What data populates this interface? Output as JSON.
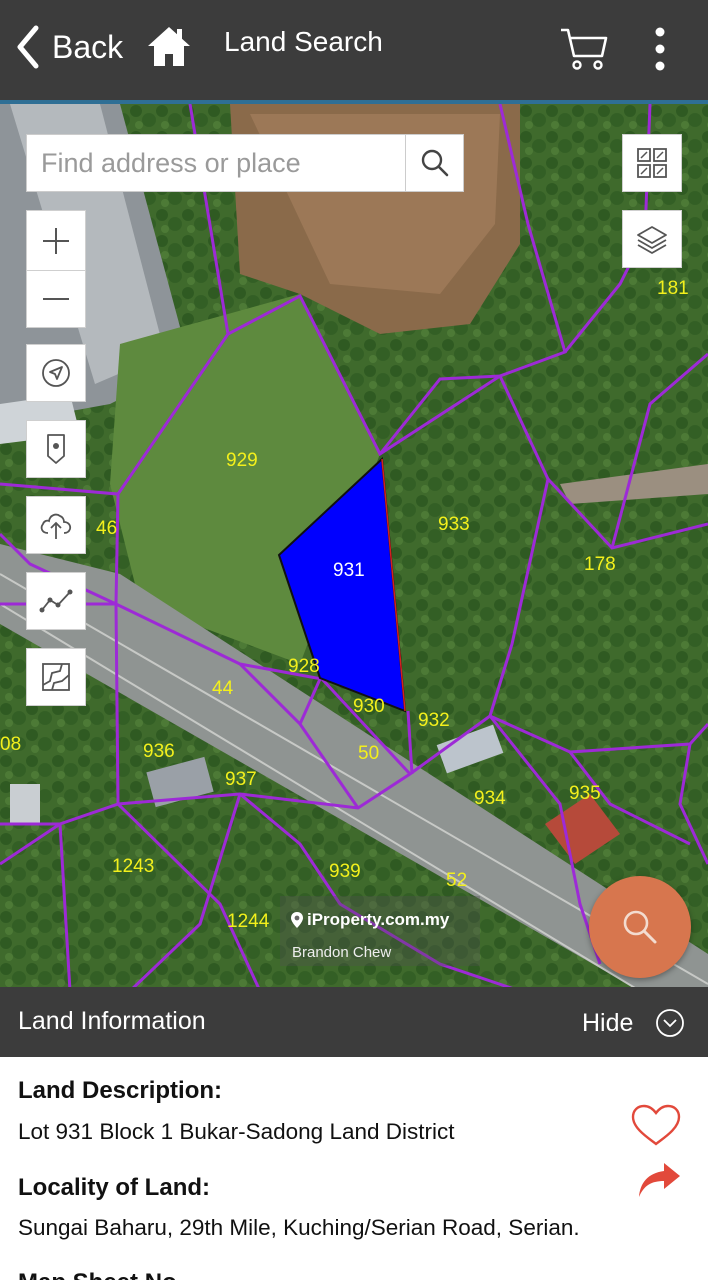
{
  "header": {
    "back_label": "Back",
    "title": "Land Search"
  },
  "map": {
    "search_placeholder": "Find address or place",
    "watermark": "iProperty.com.my",
    "credit": "Brandon Chew",
    "selected_lot": "931",
    "lots": [
      "929",
      "933",
      "46",
      "181",
      "178",
      "931",
      "928",
      "44",
      "930",
      "932",
      "50",
      "936",
      "937",
      "934",
      "935",
      "1243",
      "939",
      "52",
      "1244",
      "08"
    ],
    "boundary_color": "#9d2ad6",
    "selected_fill": "#0000ff",
    "lot_label_color": "#f3f01c"
  },
  "info": {
    "title": "Land Information",
    "hide_label": "Hide",
    "land_description_label": "Land Description:",
    "land_description": "Lot 931 Block 1 Bukar-Sadong Land District",
    "locality_label": "Locality of Land:",
    "locality": "Sungai Baharu, 29th Mile, Kuching/Serian Road, Serian.",
    "map_sheet_label": "Map Sheet No. "
  },
  "icons": {
    "back": "chevron-left-icon",
    "home": "home-icon",
    "cart": "cart-icon",
    "more": "more-vertical-icon",
    "favorite": "heart-icon",
    "share": "share-icon"
  },
  "colors": {
    "header_bg": "#3c3c3c",
    "fab": "#d7764e",
    "heart": "#e2493b",
    "share": "#e2493b"
  }
}
